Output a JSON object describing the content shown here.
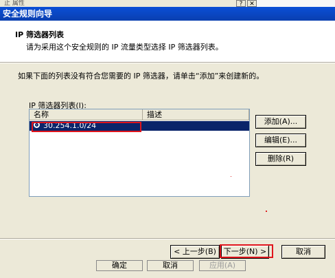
{
  "background_dialog": {
    "title_fragment": "止 属性",
    "help_button": "?",
    "close_button": "✕",
    "ok_label": "确定",
    "cancel_label": "取消",
    "apply_label": "应用(A)"
  },
  "wizard": {
    "title": "安全规则向导",
    "header_title": "IP 筛选器列表",
    "header_subtitle": "请为采用这个安全规则的 IP 流量类型选择 IP 筛选器列表。",
    "instruction": "如果下面的列表没有符合您需要的 IP 筛选器，请单击“添加”来创建新的。",
    "list_label": "IP 筛选器列表(I):",
    "columns": [
      "名称",
      "描述"
    ],
    "rows": [
      {
        "name": "30.254.1.0/24",
        "description": "",
        "selected": true
      }
    ],
    "buttons": {
      "add": "添加(A)...",
      "edit": "编辑(E)...",
      "delete": "删除(R)",
      "back": "< 上一步(B)",
      "next": "下一步(N) >",
      "cancel": "取消"
    }
  },
  "colors": {
    "title_bar": "#0a4fd6",
    "selection": "#0a246a",
    "highlight_annotation": "#e0151c"
  }
}
